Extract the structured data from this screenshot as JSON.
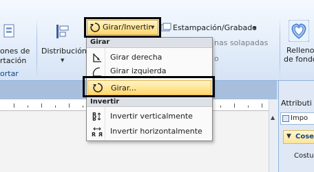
{
  "ribbon": {
    "left_group": {
      "line1": "ones de",
      "line2": "rtación",
      "group_label": "ortar"
    },
    "distribucion_label": "Distribución",
    "girar_invertir_label": "Girar/Invertir",
    "estampacion_label": "Estampación/Grabado",
    "hidden_line1": "nas solapadas",
    "hidden_line2": "o",
    "relleno_line1": "Relleno",
    "relleno_line2": "de fondo"
  },
  "right_panel": {
    "title": "Attributi",
    "tab": "Impo",
    "section": "Cose",
    "row1": "Costu"
  },
  "menu": {
    "header_girar": "Girar",
    "item_girar_derecha": "Girar derecha",
    "item_girar_izquierda": "Girar izquierda",
    "item_girar": "Girar...",
    "header_invertir": "Invertir",
    "item_invertir_vert": "Invertir verticalmente",
    "item_invertir_horiz": "Invertir horizontalmente"
  },
  "icons": {
    "rotate": "rotate-icon",
    "rotate_right": "rotate-right-icon",
    "rotate_left": "rotate-left-icon",
    "flip_vertical": "flip-vertical-icon",
    "flip_horizontal": "flip-horizontal-icon",
    "distribution": "distribution-icon",
    "stamp": "stamp-icon",
    "fill": "fill-icon"
  },
  "colors": {
    "ribbon_text": "#15428b",
    "highlight": "#ffd76a",
    "annotation_box": "#000000"
  }
}
